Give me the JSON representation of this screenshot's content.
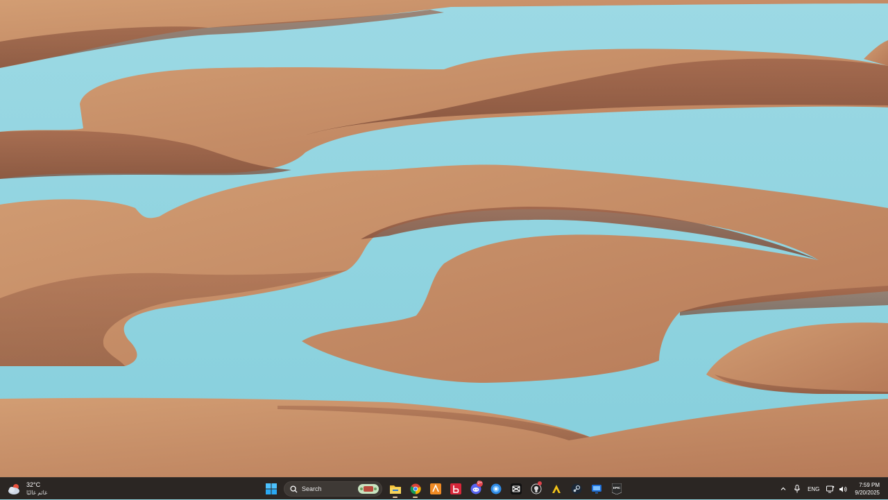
{
  "desktop": {
    "wallpaper": "sand-dunes-lagoons",
    "colors": {
      "sand": "#c48a62",
      "sand_dark": "#8a5640",
      "water": "#8fd3de"
    }
  },
  "taskbar": {
    "weather": {
      "temperature": "32°C",
      "condition": "غائم غالبًا",
      "icon": "cloud-sun-icon"
    },
    "search": {
      "placeholder": "Search"
    },
    "apps": [
      {
        "name": "file-explorer-icon"
      },
      {
        "name": "chrome-icon"
      },
      {
        "name": "app-orange-icon"
      },
      {
        "name": "app-red-icon"
      },
      {
        "name": "discord-icon",
        "badge": "9+"
      },
      {
        "name": "app-blue-icon"
      },
      {
        "name": "capcut-icon"
      },
      {
        "name": "app-github-icon"
      },
      {
        "name": "app-yellow-icon"
      },
      {
        "name": "steam-icon"
      },
      {
        "name": "app-remote-icon"
      },
      {
        "name": "epic-games-icon",
        "label": "EPIC"
      }
    ],
    "tray": {
      "language": "ENG",
      "time": "7:59 PM",
      "date": "9/20/2025"
    }
  }
}
